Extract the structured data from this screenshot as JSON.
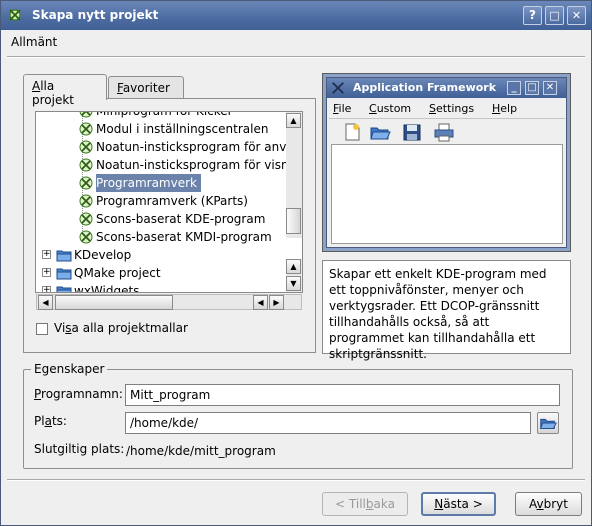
{
  "window": {
    "title": "Skapa nytt projekt",
    "help_button": "?",
    "minimize_button": "□",
    "close_button": "✕"
  },
  "section_title": "Allmänt",
  "tabs": [
    {
      "label_prefix": "",
      "label_underline": "A",
      "label_rest": "lla projekt",
      "active": true
    },
    {
      "label_prefix": "",
      "label_underline": "F",
      "label_rest": "avoriter",
      "active": false
    }
  ],
  "tree": {
    "items": [
      {
        "label": "Miniprogram för Kicker",
        "icon": "kde-template-icon",
        "partial": true
      },
      {
        "label": "Modul i inställningscentralen",
        "icon": "kde-template-icon"
      },
      {
        "label": "Noatun-insticksprogram för använ",
        "icon": "kde-template-icon"
      },
      {
        "label": "Noatun-insticksprogram för visnin",
        "icon": "kde-template-icon"
      },
      {
        "label": "Programramverk",
        "icon": "kde-template-icon",
        "selected": true
      },
      {
        "label": "Programramverk (KParts)",
        "icon": "kde-template-icon"
      },
      {
        "label": "Scons-baserat KDE-program",
        "icon": "kde-template-icon"
      },
      {
        "label": "Scons-baserat KMDI-program",
        "icon": "kde-template-icon"
      },
      {
        "label": "KDevelop",
        "icon": "folder-icon"
      },
      {
        "label": "QMake project",
        "icon": "folder-icon"
      },
      {
        "label": "wxWidgets",
        "icon": "folder-icon",
        "partial": true
      }
    ]
  },
  "show_all_checkbox": {
    "label_prefix": "Vi",
    "label_underline": "s",
    "label_rest": "a alla projektmallar",
    "checked": false
  },
  "preview": {
    "title": "Application Framework",
    "menus": [
      {
        "underline": "F",
        "rest": "ile"
      },
      {
        "underline": "C",
        "rest": "ustom"
      },
      {
        "underline": "S",
        "rest": "ettings"
      },
      {
        "underline": "H",
        "rest": "elp"
      }
    ],
    "toolbar_icons": [
      "new-document-icon",
      "open-folder-icon",
      "save-icon",
      "print-icon"
    ]
  },
  "description": "Skapar ett enkelt KDE-program med ett toppnivåfönster, menyer och verktygsrader. Ett DCOP-gränssnitt tillhandahålls också, så att programmet kan tillhandahålla ett skriptgränssnitt.",
  "properties": {
    "group_title": "Egenskaper",
    "name_label_underline": "P",
    "name_label_rest": "rogramnamn:",
    "name_value": "Mitt_program",
    "location_label_prefix": "Pl",
    "location_label_underline": "a",
    "location_label_rest": "ts:",
    "location_value": "/home/kde/",
    "final_label": "Slutgiltig plats:",
    "final_value": "/home/kde/mitt_program"
  },
  "buttons": {
    "back": {
      "prefix": "< Till",
      "underline": "b",
      "rest": "aka"
    },
    "next": {
      "prefix": "",
      "underline": "N",
      "rest": "ästa >"
    },
    "cancel": {
      "prefix": "A",
      "underline": "v",
      "rest": "bryt"
    }
  }
}
